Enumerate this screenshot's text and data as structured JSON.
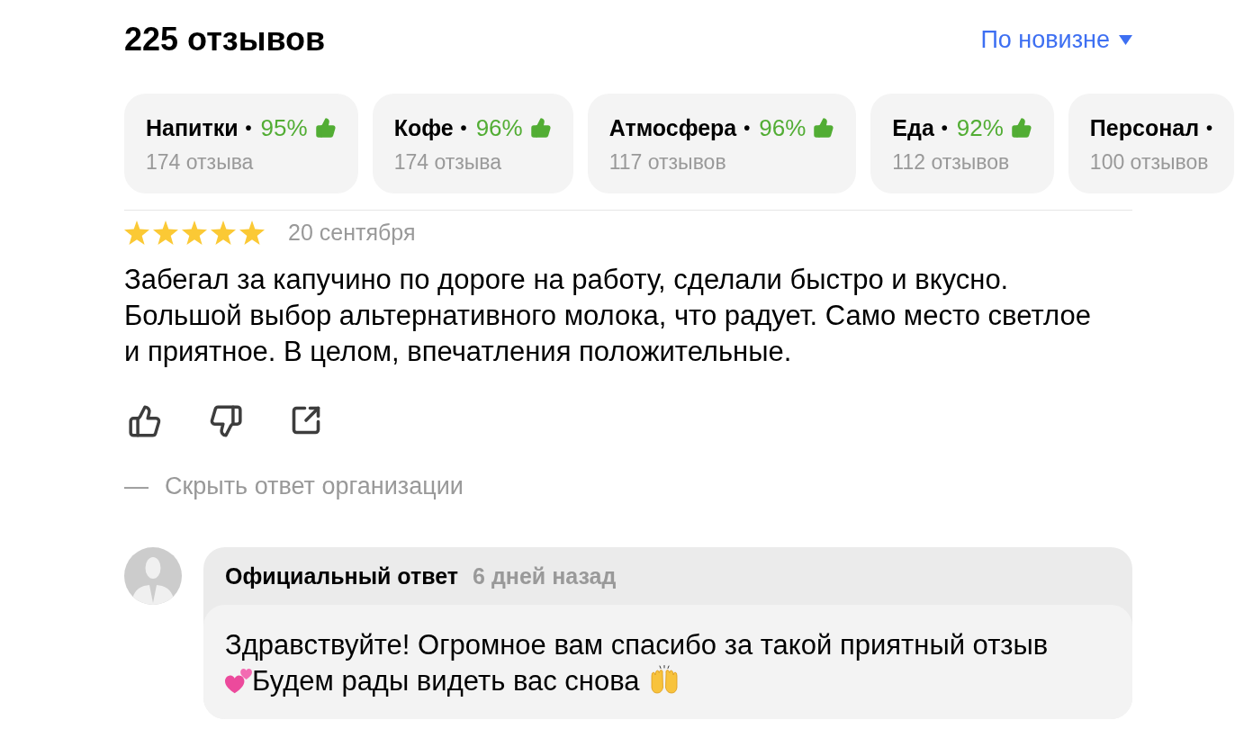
{
  "header": {
    "title": "225 отзывов",
    "sort": {
      "label": "По новизне"
    }
  },
  "categories": [
    {
      "label": "Напитки",
      "separator": "•",
      "percent": "95%",
      "count": "174 отзыва",
      "selected": false
    },
    {
      "label": "Кофе",
      "separator": "•",
      "percent": "96%",
      "count": "174 отзыва",
      "selected": false
    },
    {
      "label": "Атмосфера",
      "separator": "•",
      "percent": "96%",
      "count": "117 отзывов",
      "selected": false
    },
    {
      "label": "Еда",
      "separator": "•",
      "percent": "92%",
      "count": "112 отзывов",
      "selected": false
    },
    {
      "label": "Персонал",
      "separator": "•",
      "count": "100 отзывов",
      "selected": false
    }
  ],
  "review": {
    "stars": 5,
    "date": "20 сентября",
    "text": "Забегал за капучино по дороге на работу, сделали быстро и вкусно. Большой выбор альтернативного молока, что радует. Само место светлое и приятное. В целом, впечатления положительные."
  },
  "reply_toggle": {
    "marker": "—",
    "label": "Скрыть ответ организации",
    "expanded": true
  },
  "reply": {
    "author": "Официальный ответ",
    "time": "6 дней назад",
    "segments": [
      {
        "kind": "text",
        "text": "Здравствуйте! Огромное вам спасибо за такой приятный отзыв"
      },
      {
        "kind": "emoji"
      },
      {
        "kind": "text",
        "text": "Будем рады видеть вас снова"
      },
      {
        "kind": "emoji"
      }
    ]
  }
}
